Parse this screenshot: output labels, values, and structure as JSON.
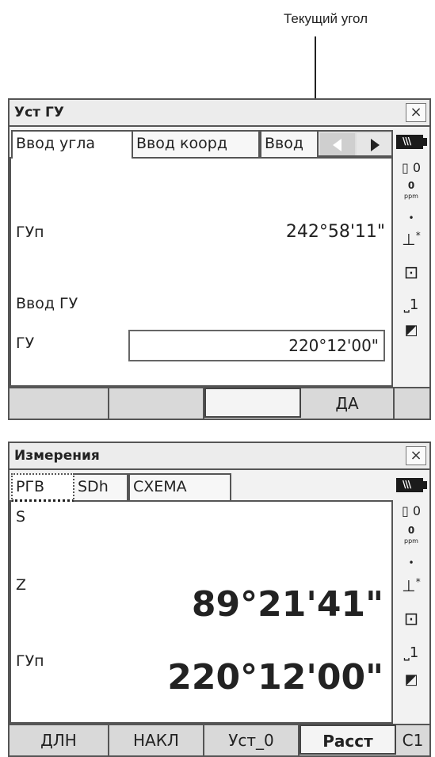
{
  "annotation": {
    "label": "Текущий угол"
  },
  "screen1": {
    "title": "Уст ГУ",
    "close_glyph": "×",
    "tabs": [
      "Ввод угла",
      "Ввод коорд",
      "Ввод"
    ],
    "hz_label": "ГУп",
    "hz_value": "242°58'11\"",
    "enter_label": "Ввод ГУ",
    "input_label": "ГУ",
    "input_value": "220°12'00\"",
    "softkeys": [
      "",
      "",
      "",
      "ДА",
      ""
    ]
  },
  "screen2": {
    "title": "Измерения",
    "close_glyph": "×",
    "tabs": [
      "РГВ",
      "SDh",
      "СХЕМА"
    ],
    "rows": [
      {
        "label": "S",
        "value": ""
      },
      {
        "label": "Z",
        "value": "89°21'41\""
      },
      {
        "label": "ГУп",
        "value": "220°12'00\""
      }
    ],
    "softkeys": [
      "ДЛН",
      "НАКЛ",
      "Уст_0",
      "Расст",
      "С1"
    ]
  },
  "status_panel": {
    "prism_const": "0",
    "ppm_value": "0",
    "ppm_unit": "ppm",
    "dot": "•",
    "level_glyph": "⊥",
    "star_glyph": "*",
    "mode_number": "1"
  },
  "icons": [
    "close-icon",
    "battery-icon",
    "prism-icon",
    "ppm-icon",
    "tilt-icon",
    "instrument-icon",
    "target-icon",
    "input-mode-icon",
    "arrow-left-icon",
    "arrow-right-icon"
  ]
}
